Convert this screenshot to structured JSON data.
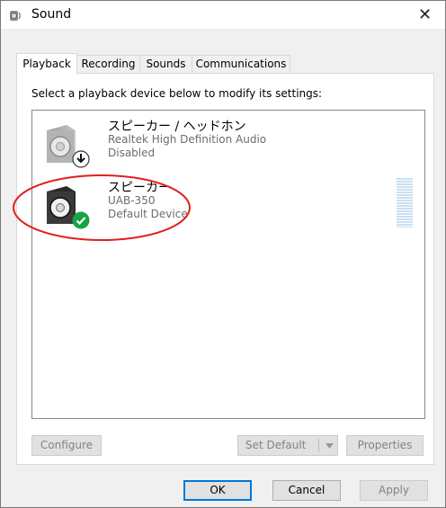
{
  "window": {
    "title": "Sound",
    "close_symbol": "✕"
  },
  "tabs": [
    {
      "label": "Playback",
      "active": true
    },
    {
      "label": "Recording",
      "active": false
    },
    {
      "label": "Sounds",
      "active": false
    },
    {
      "label": "Communications",
      "active": false
    }
  ],
  "instruction": "Select a playback device below to modify its settings:",
  "devices": [
    {
      "name": "スピーカー / ヘッドホン",
      "driver": "Realtek High Definition Audio",
      "status": "Disabled",
      "icon": "speaker-disabled-icon",
      "badge": "down-arrow-badge-icon"
    },
    {
      "name": "スピーカー",
      "driver": "UAB-350",
      "status": "Default Device",
      "icon": "speaker-default-icon",
      "badge": "green-check-badge-icon"
    }
  ],
  "buttons": {
    "configure": "Configure",
    "set_default": "Set Default",
    "properties": "Properties",
    "ok": "OK",
    "cancel": "Cancel",
    "apply": "Apply"
  },
  "annotation": {
    "color": "#e0201b"
  },
  "colors": {
    "accent": "#0078d7",
    "check_green": "#18a348",
    "disabled_text": "#838383"
  }
}
